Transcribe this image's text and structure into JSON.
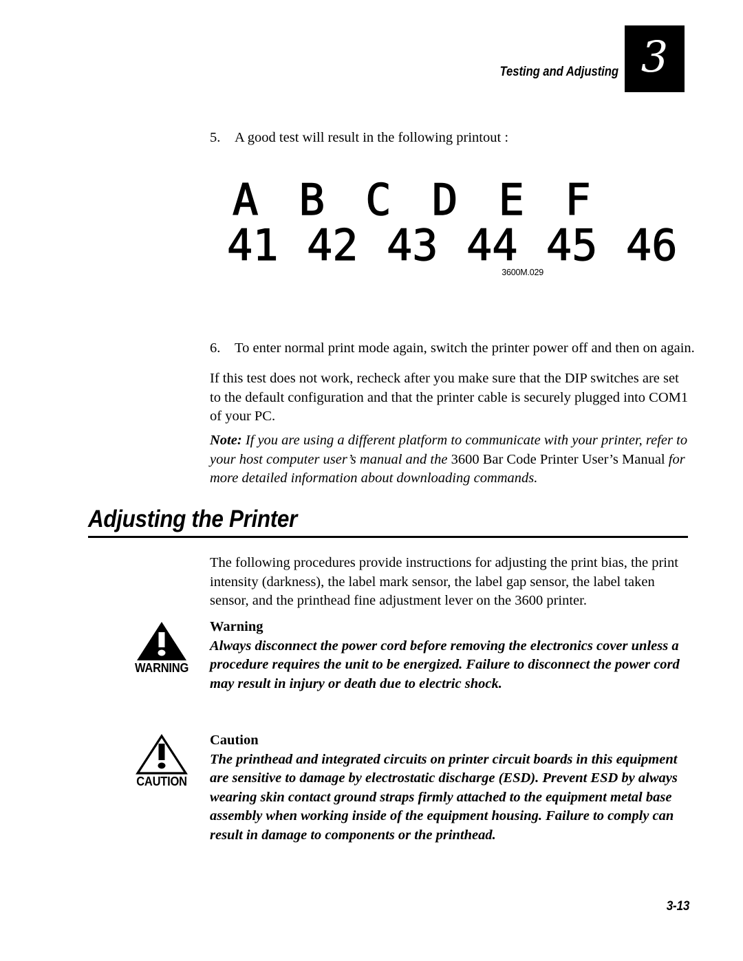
{
  "header": {
    "title": "Testing and Adjusting",
    "chapter_number": "3"
  },
  "steps": {
    "step5_num": "5.",
    "step5_text": "A good test will result in the following printout :",
    "step6_num": "6.",
    "step6_text": "To enter normal print mode again, switch the printer power off and then on again."
  },
  "figure": {
    "letters_row": "A B C D E F",
    "numbers_row": "41 42 43 44 45 46",
    "caption": "3600M.029"
  },
  "paragraphs": {
    "recheck": "If this test does not work, recheck after you make sure that the DIP switches are set to the default configuration and that the printer cable is securely plugged into COM1 of your PC.",
    "note_label": "Note:",
    "note_part1": " If you are using a different platform to communicate with your printer, refer to your host computer user’s manual and the ",
    "note_roman": "3600 Bar Code Printer User’s Manual",
    "note_part2": " for more detailed information about downloading commands.",
    "intro": "The following procedures provide instructions for adjusting the print bias, the print intensity (darkness), the label mark sensor, the label gap sensor, the label taken sensor, and the printhead fine adjustment lever on the 3600 printer."
  },
  "section": {
    "heading": "Adjusting the Printer"
  },
  "warning": {
    "icon_word": "WARNING",
    "icon_name": "warning-triangle-icon",
    "title": "Warning",
    "text": "Always disconnect the power cord before removing the electronics cover unless a procedure requires the unit to be energized. Failure to disconnect the power cord may result in injury or death due to electric shock."
  },
  "caution": {
    "icon_word": "CAUTION",
    "icon_name": "caution-triangle-icon",
    "title": "Caution",
    "text": "The printhead and integrated circuits on printer circuit boards in this equipment are sensitive to damage by electrostatic discharge (ESD). Prevent ESD by always wearing skin contact ground straps firmly attached to the equipment metal base assembly when working inside of the equipment housing. Failure to comply can result in damage to components or the printhead."
  },
  "footer": {
    "page_number": "3-13"
  },
  "colors": {
    "ink": "#000000",
    "paper": "#ffffff"
  }
}
